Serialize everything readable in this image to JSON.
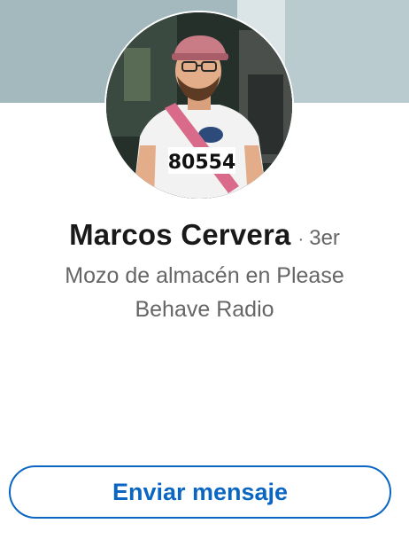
{
  "profile": {
    "name": "Marcos Cervera",
    "degree_separator": "·",
    "degree": "3er",
    "headline": "Mozo de almacén en Please Behave Radio",
    "avatar_bib_number": "80554"
  },
  "actions": {
    "message_label": "Enviar mensaje"
  },
  "colors": {
    "accent": "#0a66c2",
    "name_text": "#191919",
    "secondary_text": "#666666",
    "cover": "#a3b9bd"
  }
}
